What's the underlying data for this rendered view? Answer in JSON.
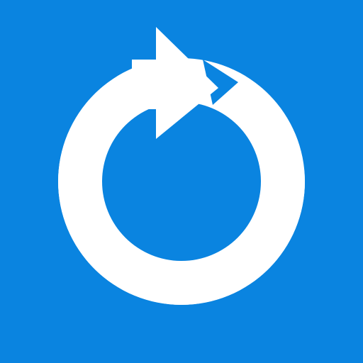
{
  "app_tile": {
    "icon": "refresh-icon",
    "colors": {
      "background": "#0A84E0",
      "foreground": "#FFFFFF"
    }
  }
}
